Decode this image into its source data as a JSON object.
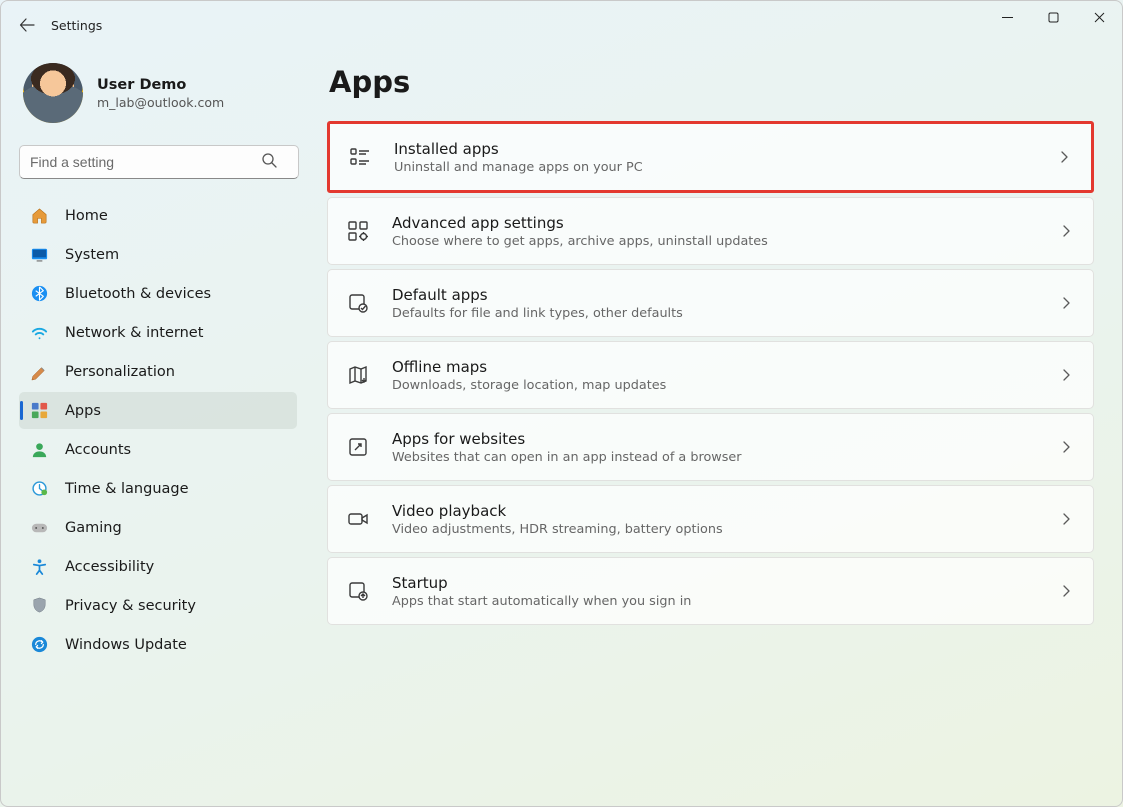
{
  "window": {
    "title": "Settings"
  },
  "user": {
    "name": "User Demo",
    "email": "m_lab@outlook.com"
  },
  "search": {
    "placeholder": "Find a setting"
  },
  "nav": {
    "home": "Home",
    "system": "System",
    "bluetooth": "Bluetooth & devices",
    "network": "Network & internet",
    "personalization": "Personalization",
    "apps": "Apps",
    "accounts": "Accounts",
    "time": "Time & language",
    "gaming": "Gaming",
    "accessibility": "Accessibility",
    "privacy": "Privacy & security",
    "update": "Windows Update"
  },
  "page": {
    "title": "Apps"
  },
  "rows": {
    "installed": {
      "title": "Installed apps",
      "sub": "Uninstall and manage apps on your PC"
    },
    "advanced": {
      "title": "Advanced app settings",
      "sub": "Choose where to get apps, archive apps, uninstall updates"
    },
    "default": {
      "title": "Default apps",
      "sub": "Defaults for file and link types, other defaults"
    },
    "offline": {
      "title": "Offline maps",
      "sub": "Downloads, storage location, map updates"
    },
    "websites": {
      "title": "Apps for websites",
      "sub": "Websites that can open in an app instead of a browser"
    },
    "video": {
      "title": "Video playback",
      "sub": "Video adjustments, HDR streaming, battery options"
    },
    "startup": {
      "title": "Startup",
      "sub": "Apps that start automatically when you sign in"
    }
  }
}
